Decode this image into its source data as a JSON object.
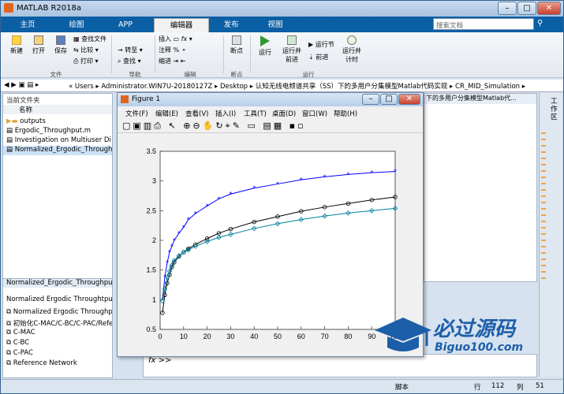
{
  "app_title": "MATLAB R2018a",
  "search_placeholder": "搜索文档",
  "tabs": [
    "主页",
    "绘图",
    "APP",
    "编辑器",
    "发布",
    "视图"
  ],
  "ribbon": {
    "file": {
      "new": "新建",
      "open": "打开",
      "save": "保存",
      "find_file": "查找文件",
      "compare": "比较",
      "print": "打印",
      "label": "文件"
    },
    "nav": {
      "goto": "转至",
      "find": "查找",
      "label": "导航"
    },
    "edit": {
      "insert": "插入",
      "comment": "注释",
      "indent": "缩进",
      "fx": "fx",
      "label": "编辑"
    },
    "breakpoints": {
      "bp": "断点",
      "label": "断点"
    },
    "run": {
      "run": "运行",
      "run_advance": "运行并\n前进",
      "run_section": "运行节",
      "advance": "前进",
      "run_time": "运行并\n计时",
      "label": "运行"
    }
  },
  "address": [
    "Users",
    "Administrator.WIN7U-20180127Z",
    "Desktop",
    "认知无线电频谱共享（SS）下的多用户分集模型Matlab代码实现",
    "CR_MID_Simulation"
  ],
  "current_folder": {
    "title": "当前文件夹",
    "col_name": "名称",
    "items": [
      "outputs",
      "Ergodic_Throughput.m",
      "Investigation on Multiuser Di",
      "Normalized_Ergodic_Throughpu"
    ]
  },
  "details": {
    "file": "Normalized_Ergodic_Throughput.m",
    "heading": "Normalized Ergodic Throughtput",
    "items": [
      "Normalized Ergodic Throughpu",
      "初始化C-MAC/C-BC/C-PAC/Refe",
      "C-MAC",
      "C-BC",
      "C-PAC",
      "Reference Network"
    ]
  },
  "editor_tab": "下的多用户分集模型Matlab代...",
  "figure": {
    "title": "Figure 1",
    "menu": [
      "文件(F)",
      "编辑(E)",
      "查看(V)",
      "插入(I)",
      "工具(T)",
      "桌面(D)",
      "窗口(W)",
      "帮助(H)"
    ]
  },
  "command": {
    "prompt": "fx >>"
  },
  "status": {
    "mode": "脚本",
    "row_label": "行",
    "row": "112",
    "col_label": "列",
    "col": "51"
  },
  "right_panel": "工作区",
  "watermark": {
    "main": "必过源码",
    "sub": "Biguo100.com"
  },
  "chart_data": {
    "type": "line",
    "xlim": [
      0,
      100
    ],
    "ylim": [
      0.5,
      3.5
    ],
    "xticks": [
      0,
      10,
      20,
      30,
      40,
      50,
      60,
      70,
      80,
      90,
      100
    ],
    "yticks": [
      0.5,
      1,
      1.5,
      2,
      2.5,
      3,
      3.5
    ],
    "grid": false,
    "series": [
      {
        "color": "#0000ff",
        "marker": "star",
        "x": [
          1,
          2,
          3,
          4,
          5,
          6,
          8,
          10,
          12,
          15,
          20,
          25,
          30,
          40,
          50,
          60,
          70,
          80,
          90,
          100
        ],
        "y": [
          1.0,
          1.38,
          1.62,
          1.8,
          1.9,
          2.0,
          2.12,
          2.22,
          2.35,
          2.45,
          2.58,
          2.7,
          2.78,
          2.88,
          2.95,
          3.02,
          3.07,
          3.11,
          3.14,
          3.16
        ]
      },
      {
        "color": "#000000",
        "marker": "circle",
        "x": [
          1,
          2,
          3,
          4,
          5,
          6,
          8,
          10,
          12,
          15,
          20,
          25,
          30,
          40,
          50,
          60,
          70,
          80,
          90,
          100
        ],
        "y": [
          0.78,
          1.08,
          1.28,
          1.42,
          1.55,
          1.63,
          1.73,
          1.8,
          1.86,
          1.93,
          2.03,
          2.12,
          2.19,
          2.31,
          2.4,
          2.49,
          2.56,
          2.62,
          2.68,
          2.73
        ]
      },
      {
        "color": "#0080a0",
        "marker": "diamond",
        "x": [
          1,
          2,
          3,
          4,
          5,
          6,
          8,
          10,
          12,
          15,
          20,
          25,
          30,
          40,
          50,
          60,
          70,
          80,
          90,
          100
        ],
        "y": [
          0.98,
          1.18,
          1.38,
          1.48,
          1.58,
          1.66,
          1.74,
          1.8,
          1.84,
          1.9,
          1.98,
          2.05,
          2.1,
          2.2,
          2.28,
          2.35,
          2.41,
          2.46,
          2.5,
          2.54
        ]
      }
    ]
  }
}
